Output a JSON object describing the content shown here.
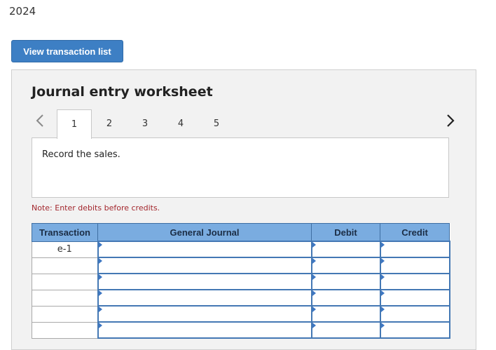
{
  "header": {
    "year": "2024"
  },
  "toolbar": {
    "view_transaction_list_label": "View transaction list"
  },
  "worksheet": {
    "title": "Journal entry worksheet",
    "nav": {
      "prev_icon": "chevron-left-icon",
      "next_icon": "chevron-right-icon"
    },
    "tabs": [
      {
        "label": "1",
        "active": true
      },
      {
        "label": "2",
        "active": false
      },
      {
        "label": "3",
        "active": false
      },
      {
        "label": "4",
        "active": false
      },
      {
        "label": "5",
        "active": false
      }
    ],
    "prompt": "Record the sales.",
    "note": "Note: Enter debits before credits.",
    "table": {
      "columns": [
        "Transaction",
        "General Journal",
        "Debit",
        "Credit"
      ],
      "rows": [
        {
          "transaction": "e-1",
          "general_journal": "",
          "debit": "",
          "credit": ""
        },
        {
          "transaction": "",
          "general_journal": "",
          "debit": "",
          "credit": ""
        },
        {
          "transaction": "",
          "general_journal": "",
          "debit": "",
          "credit": ""
        },
        {
          "transaction": "",
          "general_journal": "",
          "debit": "",
          "credit": ""
        },
        {
          "transaction": "",
          "general_journal": "",
          "debit": "",
          "credit": ""
        },
        {
          "transaction": "",
          "general_journal": "",
          "debit": "",
          "credit": ""
        }
      ]
    }
  },
  "colors": {
    "button_bg": "#3d7fc4",
    "table_header_bg": "#7aace0",
    "input_border": "#4478b4",
    "note_text": "#a3272d"
  }
}
